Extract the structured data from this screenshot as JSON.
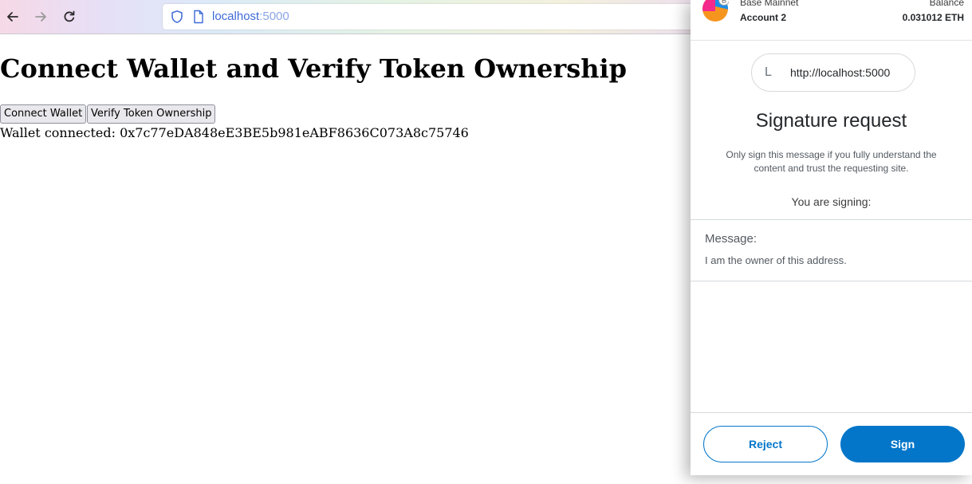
{
  "browser": {
    "url_host": "localhost",
    "url_port": ":5000"
  },
  "page": {
    "title": "Connect Wallet and Verify Token Ownership",
    "connect_button": "Connect Wallet",
    "verify_button": "Verify Token Ownership",
    "status": "Wallet connected: 0x7c77eDA848eE3BE5b981eABF8636C073A8c75746"
  },
  "wallet_popup": {
    "network": "Base Mainnet",
    "account": "Account 2",
    "balance_label": "Balance",
    "balance_value": "0.031012 ETH",
    "origin_initial": "L",
    "origin_url": "http://localhost:5000",
    "title": "Signature request",
    "warning": "Only sign this message if you fully understand the content and trust the requesting site.",
    "signing_label": "You are signing:",
    "message_label": "Message:",
    "message_text": "I am the owner of this address.",
    "reject_label": "Reject",
    "sign_label": "Sign"
  },
  "colors": {
    "accent": "#0376c9",
    "url_host": "#3d6ad8"
  }
}
